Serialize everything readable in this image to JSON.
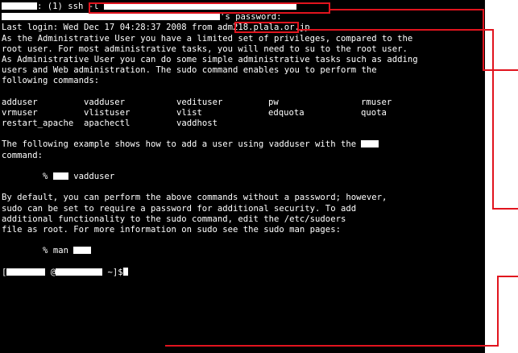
{
  "terminal": {
    "background": "#000000",
    "foreground": "#ffffff",
    "annotation_color": "#e1141e",
    "command_prompt": ": (1) ssh -l",
    "password_prompt": "s password:",
    "last_login": "Last login: Wed Dec 17 04:28:37 2008 from adm218.plala.or.jp",
    "motd": [
      "As the Administrative User you have a limited set of privileges, compared to the",
      "root user. For most administrative tasks, you will need to su to the root user.",
      "As Administrative User you can do some simple administrative tasks such as adding",
      "users and Web administration. The sudo command enables you to perform the",
      "following commands:"
    ],
    "commands_table": [
      [
        "adduser",
        "vadduser",
        "vedituser",
        "pw",
        "rmuser"
      ],
      [
        "vrmuser",
        "vlistuser",
        "vlist",
        "edquota",
        "quota"
      ],
      [
        "restart_apache",
        "apachectl",
        "vaddhost",
        "",
        ""
      ]
    ],
    "example_intro_1": "The following example shows how to add a user using vadduser with the",
    "example_intro_2": "command:",
    "example_prompt": "%",
    "example_command": "vadduser",
    "sudo_text": [
      "By default, you can perform the above commands without a password; however,",
      "sudo can be set to require a password for additional security. To add",
      "additional functionality to the sudo command, edit the /etc/sudoers",
      "file as root. For more information on sudo see the sudo man pages:"
    ],
    "man_prompt": "%",
    "man_command": "man",
    "shell_prompt_open": "[",
    "shell_prompt_at": "@",
    "shell_prompt_close": " ~]$"
  }
}
